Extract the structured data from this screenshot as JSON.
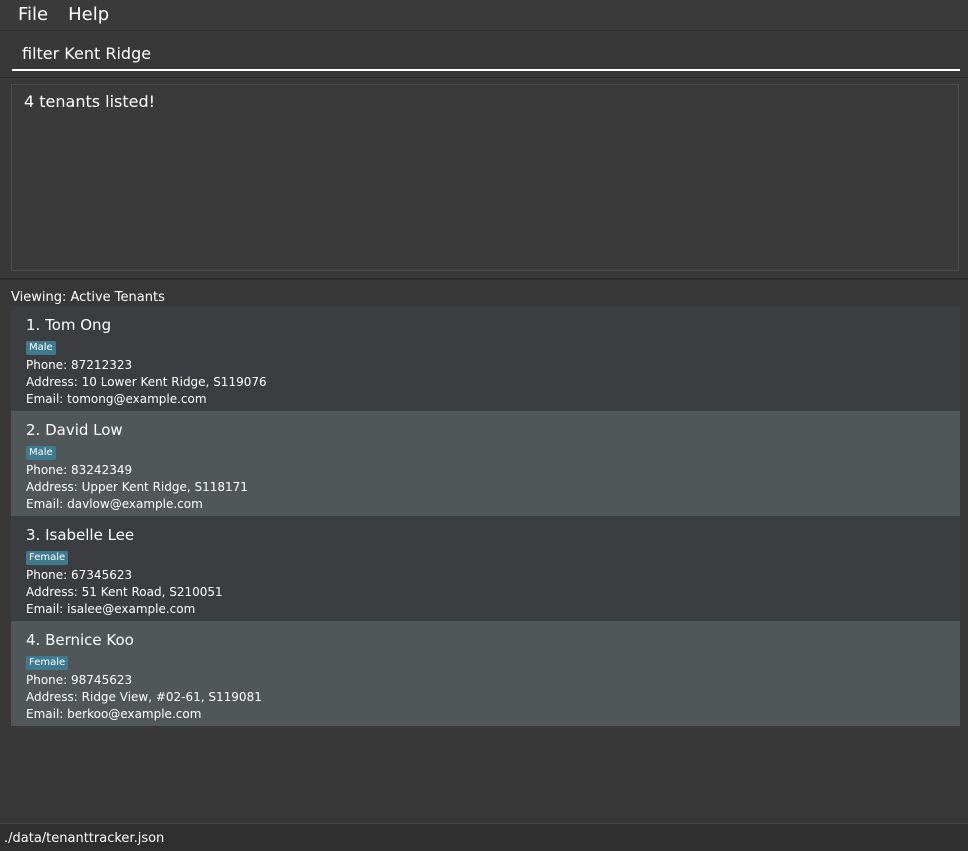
{
  "menu": {
    "file_label": "File",
    "help_label": "Help"
  },
  "command": {
    "value": "filter Kent Ridge"
  },
  "result": {
    "message": "4 tenants listed!"
  },
  "list": {
    "viewing_label": "Viewing: Active Tenants",
    "tenants": [
      {
        "name": "1. Tom Ong",
        "tag": "Male",
        "phone": "Phone: 87212323",
        "address": "Address: 10 Lower Kent Ridge, S119076",
        "email": "Email: tomong@example.com"
      },
      {
        "name": "2. David Low",
        "tag": "Male",
        "phone": "Phone: 83242349",
        "address": "Address: Upper Kent Ridge, S118171",
        "email": "Email: davlow@example.com"
      },
      {
        "name": "3. Isabelle Lee",
        "tag": "Female",
        "phone": "Phone: 67345623",
        "address": "Address: 51 Kent Road, S210051",
        "email": "Email: isalee@example.com"
      },
      {
        "name": "4. Bernice Koo",
        "tag": "Female",
        "phone": "Phone: 98745623",
        "address": "Address: Ridge View, #02-61, S119081",
        "email": "Email: berkoo@example.com"
      }
    ]
  },
  "status": {
    "file_path": "./data/tenanttracker.json"
  },
  "colors": {
    "background": "#383838",
    "card_odd": "#3b3d40",
    "card_even": "#515658",
    "tag": "#3e7b91"
  }
}
